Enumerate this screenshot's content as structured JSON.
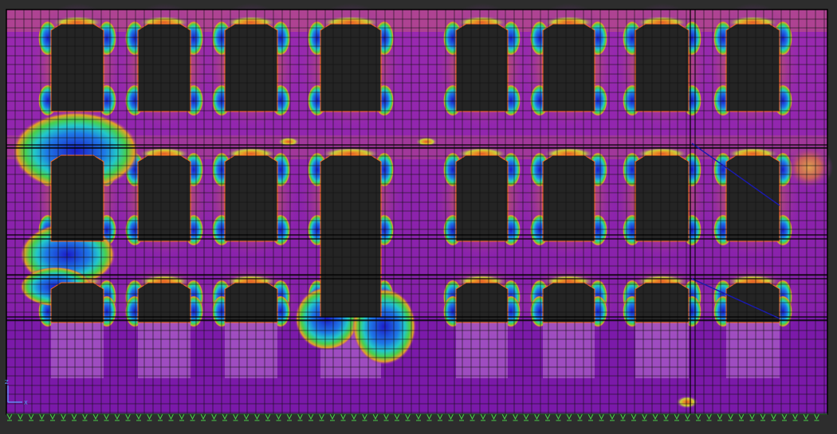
{
  "viewport": {
    "background_color": "#2d2d2d",
    "wall_color": "#8a22b8",
    "mesh_line_color": "#101010",
    "opening_color": "#252525",
    "support_color": "#4ad04a"
  },
  "contour_palette": [
    "#1c1cc8",
    "#1e78e6",
    "#22c8c8",
    "#4ad04a",
    "#c8d23c",
    "#e6a028",
    "#e65a28",
    "#c83a5a",
    "#a42a9a",
    "#8a22b8"
  ],
  "axis_triad": {
    "z_label": "Z",
    "x_label": "X",
    "icon": "axis-triad-icon"
  }
}
